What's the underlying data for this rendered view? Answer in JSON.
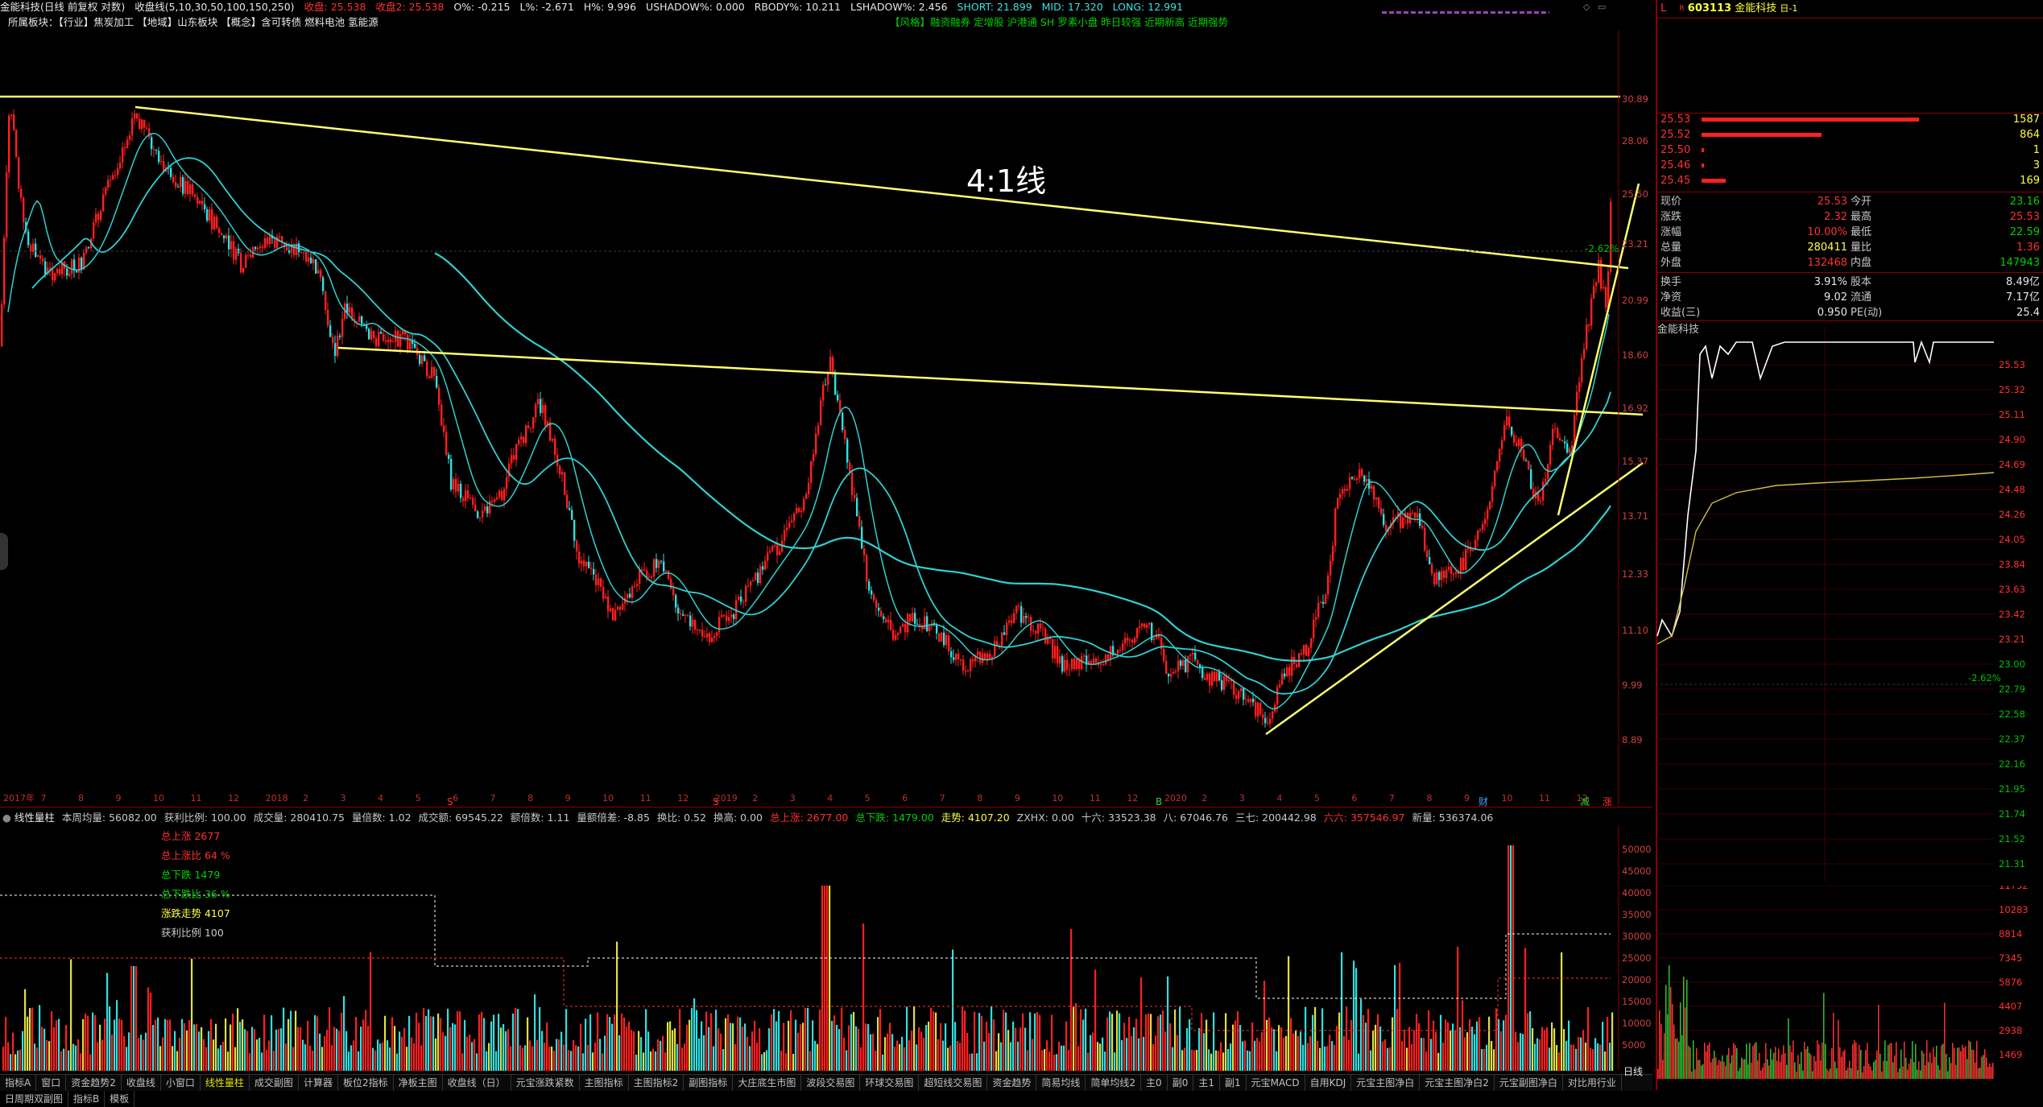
{
  "header": {
    "stock_label": "金能科技(日线 前复权 对数)",
    "ma_label": "收盘线(5,10,30,50,100,150,250)",
    "close1": "收盘: 25.538",
    "close2": "收盘2: 25.538",
    "o_pct": "O%: -0.215",
    "l_pct": "L%: -2.671",
    "h_pct": "H%: 9.996",
    "ushadow": "USHADOW%: 0.000",
    "rbody": "RBODY%: 10.211",
    "lshadow": "LSHADOW%: 2.456",
    "short": "SHORT: 21.899",
    "mid": "MID: 17.320",
    "long": "LONG: 12.991"
  },
  "line2": {
    "sector": "所属板块：【行业】焦炭加工 【地域】山东板块 【概念】含可转债 燃料电池 氢能源",
    "style": "【风格】融资融券 定增股 沪港通 SH 罗素小盘 昨日较强 近期新高 近期强势"
  },
  "chart": {
    "annotation": "4:1线",
    "pct_mark": "-2.62%",
    "price_ticks": [
      "30.89",
      "28.06",
      "25.50",
      "23.21",
      "20.99",
      "18.60",
      "16.92",
      "15.37",
      "13.71",
      "12.33",
      "11.10",
      "9.99",
      "8.89"
    ],
    "time_ticks": [
      "2017年",
      "7",
      "8",
      "9",
      "10",
      "11",
      "12",
      "2018",
      "2",
      "3",
      "4",
      "5",
      "6",
      "7",
      "8",
      "9",
      "10",
      "11",
      "12",
      "2019",
      "2",
      "3",
      "4",
      "5",
      "6",
      "7",
      "8",
      "9",
      "10",
      "11",
      "12",
      "2020",
      "2",
      "3",
      "4",
      "5",
      "6",
      "7",
      "8",
      "9",
      "10",
      "11",
      "12"
    ],
    "markers": [
      "S",
      "S",
      "B",
      "财",
      "减",
      "涨"
    ],
    "colors": {
      "bull": "#ff2020",
      "bear": "#30e0e0",
      "line": "#ffff60",
      "ma": "#30d0d0"
    }
  },
  "volume": {
    "header_items": [
      {
        "text": "线性量柱",
        "cls": "white"
      },
      {
        "text": "本周均量: 56082.00",
        "cls": "wg"
      },
      {
        "text": "获利比例: 100.00",
        "cls": "wg"
      },
      {
        "text": "成交量: 280410.75",
        "cls": "wg"
      },
      {
        "text": "量倍数: 1.02",
        "cls": "wg"
      },
      {
        "text": "成交额: 69545.22",
        "cls": "wg"
      },
      {
        "text": "额倍数: 1.11",
        "cls": "wg"
      },
      {
        "text": "量额倍差: -8.85",
        "cls": "wg"
      },
      {
        "text": "换比: 0.52",
        "cls": "wg"
      },
      {
        "text": "换高: 0.00",
        "cls": "wg"
      },
      {
        "text": "总上涨: 2677.00",
        "cls": "red"
      },
      {
        "text": "总下跌: 1479.00",
        "cls": "green"
      },
      {
        "text": "走势: 4107.20",
        "cls": "yellow"
      },
      {
        "text": "ZXHX: 0.00",
        "cls": "wg"
      },
      {
        "text": "十六: 33523.38",
        "cls": "wg"
      },
      {
        "text": "八: 67046.76",
        "cls": "wg"
      },
      {
        "text": "三七: 200442.98",
        "cls": "wg"
      },
      {
        "text": "六六: 357546.97",
        "cls": "red"
      },
      {
        "text": "新量: 536374.06",
        "cls": "wg"
      }
    ],
    "legend": [
      {
        "text": "总上涨 2677",
        "cls": "red"
      },
      {
        "text": "总上涨比 64 %",
        "cls": "red"
      },
      {
        "text": "总下跌 1479",
        "cls": "green"
      },
      {
        "text": "总下跌比 36 %",
        "cls": "green"
      },
      {
        "text": "涨跌走势 4107",
        "cls": "yellow"
      },
      {
        "text": "获利比例 100",
        "cls": "wg"
      }
    ],
    "vol_ticks": [
      "50000",
      "45000",
      "40000",
      "35000",
      "30000",
      "25000",
      "20000",
      "15000",
      "10000",
      "5000"
    ]
  },
  "bottom_tabs": [
    "指标A",
    "窗口",
    "资金趋势2",
    "收盘线",
    "小窗口",
    "线性量柱",
    "成交副图",
    "计算器",
    "板位2指标",
    "净板主图",
    "收盘线（日）",
    "元宝涨跌紧数",
    "主图指标",
    "主图指标2",
    "副图指标",
    "大庄底生市图",
    "波段交易图",
    "环球交易图",
    "超短线交易图",
    "资金趋势",
    "简易均线",
    "简单均线2",
    "主0",
    "副0",
    "主1",
    "副1",
    "元宝MACD",
    "自用KDJ",
    "元宝主图净白",
    "元宝主图净白2",
    "元宝副图净白",
    "对比用行业",
    "日周期双副图",
    "指标B",
    "模板"
  ],
  "bottom_right": "日线",
  "quote": {
    "code": "603113",
    "name": "金能科技",
    "tag": "日-1",
    "sell_prices": [
      "25.53",
      "25.52",
      "25.50",
      "25.46",
      "25.45"
    ],
    "sell_vols": [
      "1587",
      "864",
      "1",
      "3",
      "169"
    ],
    "sell_bar_fractions": [
      1.0,
      0.55,
      0.01,
      0.01,
      0.11
    ],
    "rows": [
      {
        "l1": "现价",
        "v1": "25.53",
        "c1": "red",
        "l2": "今开",
        "v2": "23.16",
        "c2": "green"
      },
      {
        "l1": "涨跌",
        "v1": "2.32",
        "c1": "red",
        "l2": "最高",
        "v2": "25.53",
        "c2": "red"
      },
      {
        "l1": "涨幅",
        "v1": "10.00%",
        "c1": "red",
        "l2": "最低",
        "v2": "22.59",
        "c2": "green"
      },
      {
        "l1": "总量",
        "v1": "280411",
        "c1": "yellow",
        "l2": "量比",
        "v2": "1.36",
        "c2": "red"
      },
      {
        "l1": "外盘",
        "v1": "132468",
        "c1": "red",
        "l2": "内盘",
        "v2": "147943",
        "c2": "green"
      }
    ],
    "rows2": [
      {
        "l1": "换手",
        "v1": "3.91%",
        "l2": "股本",
        "v2": "8.49亿"
      },
      {
        "l1": "净资",
        "v1": "9.02",
        "l2": "流通",
        "v2": "7.17亿"
      },
      {
        "l1": "收益(三)",
        "v1": "0.950",
        "l2": "PE(动)",
        "v2": "25.4"
      }
    ],
    "intraday_title": "金能科技",
    "intraday_ticks": [
      "25.53",
      "25.32",
      "25.11",
      "24.90",
      "24.69",
      "24.48",
      "24.26",
      "24.05",
      "23.84",
      "23.63",
      "23.42",
      "23.21",
      "23.00",
      "22.79",
      "22.58",
      "22.37",
      "22.16",
      "21.95",
      "21.74",
      "21.52",
      "21.31"
    ],
    "intraday_pct": "-2.62%",
    "intraday_vol_ticks": [
      "11752",
      "10283",
      "8814",
      "7345",
      "5876",
      "4407",
      "2938",
      "1469"
    ]
  }
}
